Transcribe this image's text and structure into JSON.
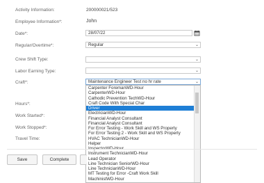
{
  "form": {
    "activity_info": {
      "label": "Activity Information:",
      "value": "200000021/523"
    },
    "employee_info": {
      "label": "Employee Information*:",
      "value": "John"
    },
    "date": {
      "label": "Date*:",
      "value": "28/07/22"
    },
    "regular_overtime": {
      "label": "Regular/Overtime*:",
      "value": "Regular"
    },
    "crew_shift": {
      "label": "Crew Shift Type:",
      "value": ""
    },
    "labor_earning": {
      "label": "Labor Earning Type:",
      "value": ""
    },
    "craft": {
      "label": "Craft*:",
      "value": "Maintenance Engineer Test no hr rate"
    },
    "hours": {
      "label": "Hours*:"
    },
    "work_started": {
      "label": "Work Started*:"
    },
    "work_stopped": {
      "label": "Work Stopped*:"
    },
    "travel_time": {
      "label": "Travel Time:"
    }
  },
  "craft_options": [
    "Carpenter ForemanWD-Hour",
    "CarpenterWD-Hour",
    "Cathodic Prevention TechWD-Hour",
    "Craft Code With Special Char",
    "Driver",
    "ElectricianWD-Hour",
    "Financial Analyst Consultant",
    "Financial Analyst Consultant",
    "For Error Testing - Work Skill and WS Property",
    "For Error Testing 2 - Work Skill and WS Property",
    "HVAC TechnicianWD-Hour",
    "Helper",
    "InspectorWD-Hour",
    "Instrument TechnicianWD-Hour",
    "Lead Operator",
    "Line Technician SeniorWD-Hour",
    "Line TechnicianWD-Hour",
    "MT Testing for Error -Craft Work Skill",
    "MachinistWD-Hour"
  ],
  "selected_option_index": 4,
  "buttons": {
    "save": "Save",
    "complete": "Complete"
  },
  "icons": {
    "calendar": "calendar-icon",
    "chevron": "chevron-down-icon"
  }
}
